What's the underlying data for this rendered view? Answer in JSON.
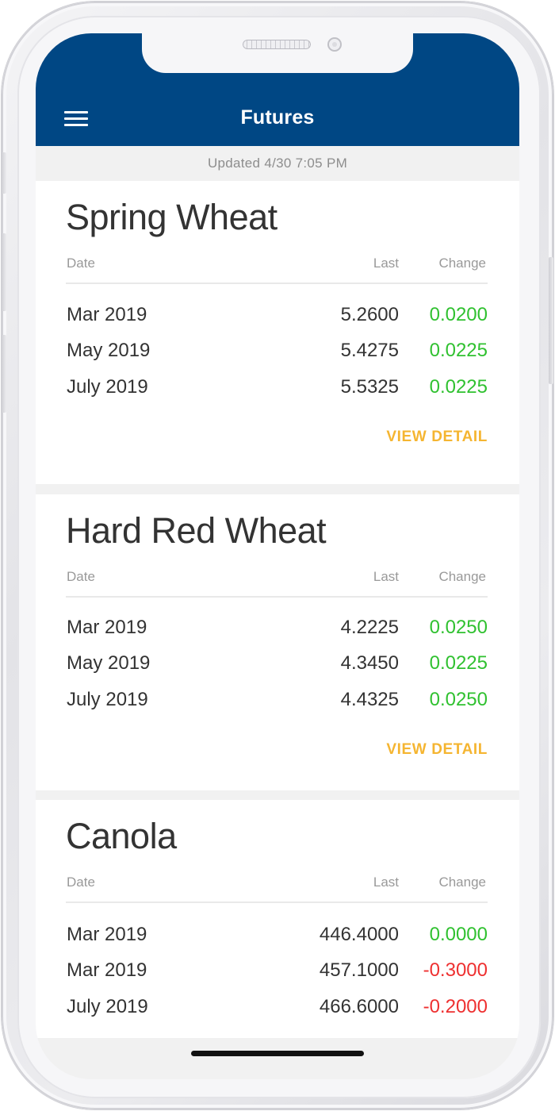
{
  "header": {
    "title": "Futures",
    "menu_icon": "hamburger-menu-icon"
  },
  "updated": "Updated 4/30 7:05 PM",
  "columns": {
    "date": "Date",
    "last": "Last",
    "change": "Change"
  },
  "cards": [
    {
      "title": "Spring Wheat",
      "rows": [
        {
          "date": "Mar 2019",
          "last": "5.2600",
          "change": "0.0200",
          "direction": "up"
        },
        {
          "date": "May 2019",
          "last": "5.4275",
          "change": "0.0225",
          "direction": "up"
        },
        {
          "date": "July 2019",
          "last": "5.5325",
          "change": "0.0225",
          "direction": "up"
        }
      ],
      "action": "VIEW DETAIL"
    },
    {
      "title": "Hard Red Wheat",
      "rows": [
        {
          "date": "Mar 2019",
          "last": "4.2225",
          "change": "0.0250",
          "direction": "up"
        },
        {
          "date": "May 2019",
          "last": "4.3450",
          "change": "0.0225",
          "direction": "up"
        },
        {
          "date": "July 2019",
          "last": "4.4325",
          "change": "0.0250",
          "direction": "up"
        }
      ],
      "action": "VIEW DETAIL"
    },
    {
      "title": "Canola",
      "rows": [
        {
          "date": "Mar 2019",
          "last": "446.4000",
          "change": "0.0000",
          "direction": "up"
        },
        {
          "date": "Mar 2019",
          "last": "457.1000",
          "change": "-0.3000",
          "direction": "down"
        },
        {
          "date": "July 2019",
          "last": "466.6000",
          "change": "-0.2000",
          "direction": "down"
        }
      ],
      "action": ""
    }
  ],
  "colors": {
    "app_bar": "#004784",
    "positive": "#30c130",
    "negative": "#ee3030",
    "action": "#f5b531"
  }
}
